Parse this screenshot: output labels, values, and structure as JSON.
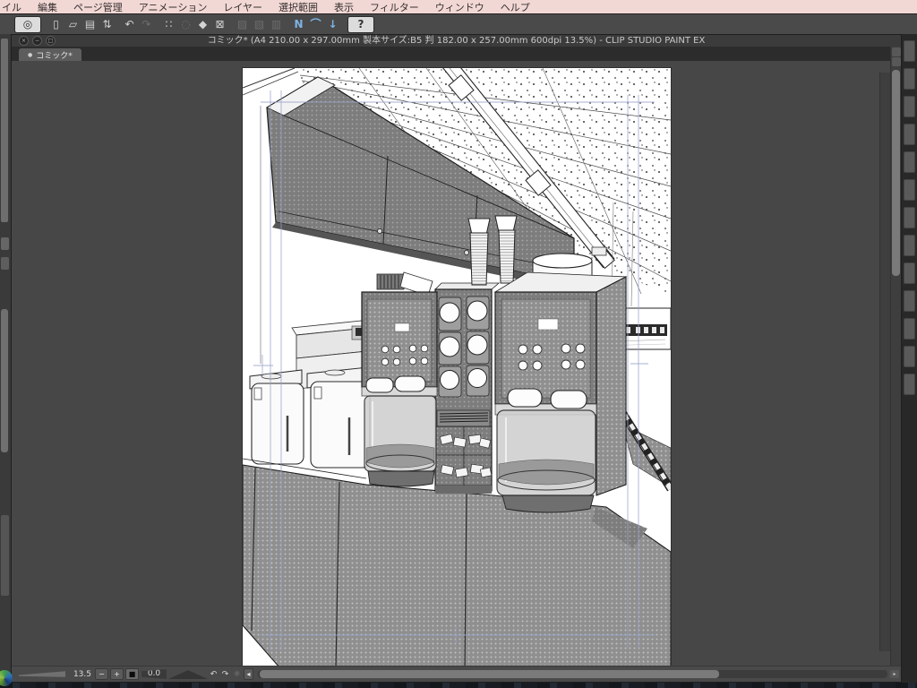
{
  "menu_bar": {
    "items": [
      "イル",
      "編集",
      "ページ管理",
      "アニメーション",
      "レイヤー",
      "選択範囲",
      "表示",
      "フィルター",
      "ウィンドウ",
      "ヘルプ"
    ]
  },
  "toolbar": {
    "icons": [
      {
        "name": "clip-studio-logo",
        "glyph": "◎"
      },
      {
        "name": "new-file",
        "glyph": "▯"
      },
      {
        "name": "open-file",
        "glyph": "▱"
      },
      {
        "name": "save-file",
        "glyph": "▤"
      },
      {
        "name": "size-stepper",
        "glyph": "⇅"
      },
      {
        "name": "undo",
        "glyph": "↶"
      },
      {
        "name": "redo",
        "glyph": "↷"
      },
      {
        "name": "deselect",
        "glyph": "∷"
      },
      {
        "name": "reselect",
        "glyph": "◌"
      },
      {
        "name": "fill-tool",
        "glyph": "◆"
      },
      {
        "name": "transform",
        "glyph": "⊠"
      },
      {
        "name": "snap-ruler",
        "glyph": "▨"
      },
      {
        "name": "snap-special-ruler",
        "glyph": "▧"
      },
      {
        "name": "snap-grid",
        "glyph": "▥"
      },
      {
        "name": "snap-line",
        "glyph": "N"
      },
      {
        "name": "snap-curve",
        "glyph": "⌒"
      },
      {
        "name": "snap-pin",
        "glyph": "↓"
      },
      {
        "name": "help",
        "glyph": "?"
      }
    ]
  },
  "document_window": {
    "title": "コミック* (A4 210.00 x 297.00mm 製本サイズ:B5 判 182.00 x 257.00mm 600dpi 13.5%)  - CLIP STUDIO PAINT EX",
    "controls": {
      "close": "×",
      "minimize": "−",
      "maximize": "□"
    },
    "tab": {
      "label": "コミック*",
      "modified_dot": "●"
    }
  },
  "status_bar": {
    "zoom": {
      "value": "13.5",
      "zoom_out": "−",
      "zoom_in": "+",
      "fit": "■"
    },
    "rotation": {
      "value": "0.0",
      "rotate_left": "↶",
      "rotate_right": "↷",
      "reset": "☼",
      "collapse": "◂"
    },
    "hscroll_arrow": "▸"
  },
  "colors": {
    "menu_bar_bg": "#f2d8d5",
    "toolbar_bg": "#4a4a4a",
    "workspace_bg": "#474747",
    "page_bg": "#ffffff",
    "snap_icon_blue": "#7db4e4",
    "margin_guide_blue": "#98a2c8"
  }
}
